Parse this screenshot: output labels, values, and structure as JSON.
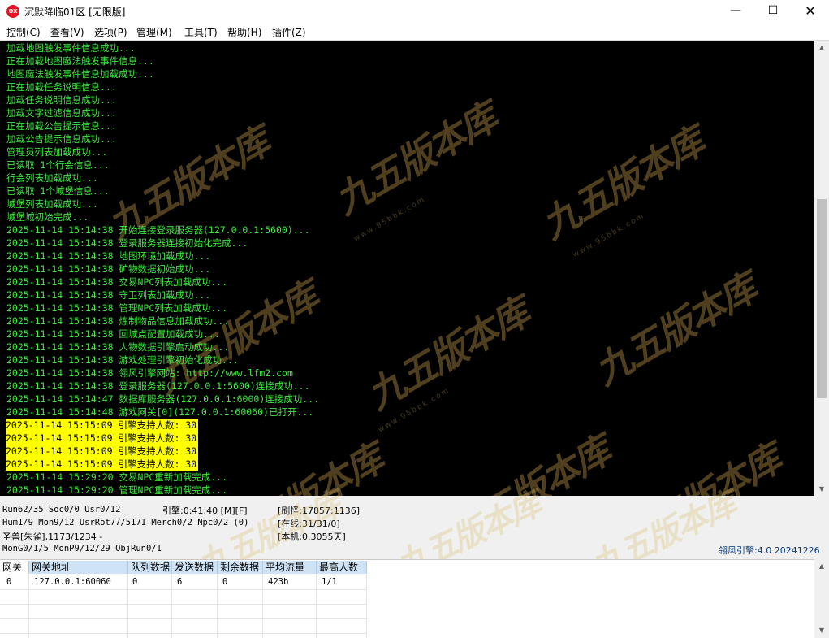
{
  "window": {
    "title": "沉默降临01区 [无限版]",
    "icon_text": "OX",
    "controls": [
      "minimize-icon",
      "maximize-icon",
      "close-icon"
    ]
  },
  "menu": [
    {
      "label": "控制(C)"
    },
    {
      "label": "查看(V)"
    },
    {
      "label": "选项(P)"
    },
    {
      "label": "管理(M)"
    },
    {
      "label": "工具(T)"
    },
    {
      "label": "帮助(H)"
    },
    {
      "label": "插件(Z)"
    }
  ],
  "console": {
    "lines": [
      {
        "text": "加载地图触发事件信息成功...",
        "hl": false
      },
      {
        "text": "正在加载地图魔法触发事件信息...",
        "hl": false
      },
      {
        "text": "地图魔法触发事件信息加载成功...",
        "hl": false
      },
      {
        "text": "正在加载任务说明信息...",
        "hl": false
      },
      {
        "text": "加载任务说明信息成功...",
        "hl": false
      },
      {
        "text": "加载文字过滤信息成功...",
        "hl": false
      },
      {
        "text": "正在加载公告提示信息...",
        "hl": false
      },
      {
        "text": "加载公告提示信息成功...",
        "hl": false
      },
      {
        "text": "管理员列表加载成功...",
        "hl": false
      },
      {
        "text": "已读取 1个行会信息...",
        "hl": false
      },
      {
        "text": "行会列表加载成功...",
        "hl": false
      },
      {
        "text": "已读取 1个城堡信息...",
        "hl": false
      },
      {
        "text": "城堡列表加载成功...",
        "hl": false
      },
      {
        "text": "城堡城初始完成...",
        "hl": false
      },
      {
        "text": "2025-11-14 15:14:38 开始连接登录服务器(127.0.0.1:5600)...",
        "hl": false
      },
      {
        "text": "2025-11-14 15:14:38 登录服务器连接初始化完成...",
        "hl": false
      },
      {
        "text": "2025-11-14 15:14:38 地图环境加载成功...",
        "hl": false
      },
      {
        "text": "2025-11-14 15:14:38 矿物数据初始成功...",
        "hl": false
      },
      {
        "text": "2025-11-14 15:14:38 交易NPC列表加载成功...",
        "hl": false
      },
      {
        "text": "2025-11-14 15:14:38 守卫列表加载成功...",
        "hl": false
      },
      {
        "text": "2025-11-14 15:14:38 管理NPC列表加载成功...",
        "hl": false
      },
      {
        "text": "2025-11-14 15:14:38 炼制物品信息加载成功...",
        "hl": false
      },
      {
        "text": "2025-11-14 15:14:38 回城点配置加载成功...",
        "hl": false
      },
      {
        "text": "2025-11-14 15:14:38 人物数据引擎启动成功...",
        "hl": false
      },
      {
        "text": "2025-11-14 15:14:38 游戏处理引擎初始化成功...",
        "hl": false
      },
      {
        "text": "2025-11-14 15:14:38 翎风引擎网站: http://www.lfm2.com",
        "hl": false
      },
      {
        "text": "2025-11-14 15:14:38 登录服务器(127.0.0.1:5600)连接成功...",
        "hl": false
      },
      {
        "text": "2025-11-14 15:14:47 数据库服务器(127.0.0.1:6000)连接成功...",
        "hl": false
      },
      {
        "text": "2025-11-14 15:14:48 游戏网关[0](127.0.0.1:60060)已打开...",
        "hl": false
      },
      {
        "text": "2025-11-14 15:15:09 引擎支持人数: 30",
        "hl": true
      },
      {
        "text": "2025-11-14 15:15:09 引擎支持人数: 30",
        "hl": true
      },
      {
        "text": "2025-11-14 15:15:09 引擎支持人数: 30",
        "hl": true
      },
      {
        "text": "2025-11-14 15:15:09 引擎支持人数: 30",
        "hl": true
      },
      {
        "text": "2025-11-14 15:29:20 交易NPC重新加载完成...",
        "hl": false
      },
      {
        "text": "2025-11-14 15:29:20 管理NPC重新加载完成...",
        "hl": false
      }
    ],
    "highlight_color": "#ffff00",
    "text_color": "#3fe73f"
  },
  "watermark": {
    "text": "九五版本库",
    "url": "www.95bbk.com"
  },
  "status": {
    "run": "Run62/35 Soc0/0 Usr0/12",
    "engine_time": "引擎:0:41:40 [M][F]",
    "refresh": "[刷怪:17857:1136]",
    "hum": "Hum1/9 Mon9/12 UsrRot77/5171 Merch0/2 Npc0/2 (0)",
    "online": "[在线:31/31/0]",
    "monster": "圣兽[朱雀],1173/1234 -",
    "uptime": "[本机:0.3055天]",
    "mon": "MonG0/1/5 MonP9/12/29 ObjRun0/1",
    "engine_version": "翎风引擎:4.0 20241226"
  },
  "gateway_table": {
    "headers": [
      "网关",
      "网关地址",
      "队列数据",
      "发送数据",
      "剩余数据",
      "平均流量",
      "最高人数"
    ],
    "rows": [
      [
        "0",
        "127.0.0.1:60060",
        "0",
        "6",
        "0",
        "423b",
        "1/1"
      ]
    ]
  }
}
